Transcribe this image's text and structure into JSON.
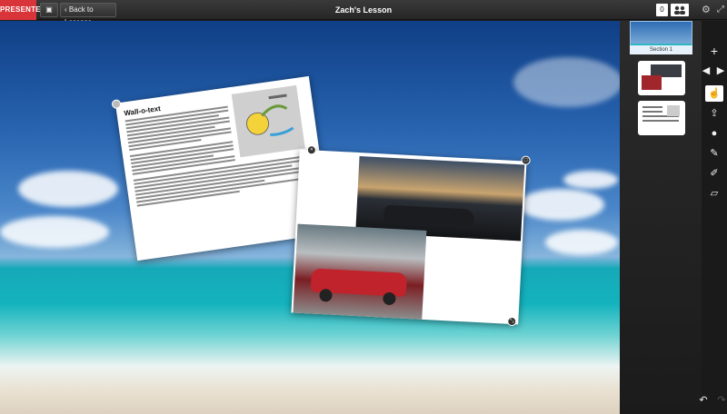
{
  "header": {
    "presenter_label": "PRESENTER",
    "back_label": "Back to Lessons",
    "title": "Zach's Lesson",
    "count": "0"
  },
  "sidebar": {
    "section_label": "Section 1"
  },
  "cards": {
    "text_card_title": "Wall-o-text"
  },
  "colors": {
    "presenter_red": "#d9343a",
    "toolbar_dark": "#2f2f2f",
    "sidebar_dark": "#1c1c1c"
  },
  "icons": {
    "folder": "folder-icon",
    "back": "chevron-left-icon",
    "people": "people-icon",
    "settings": "gear-icon",
    "fullscreen": "fullscreen-icon",
    "add": "plus-icon",
    "prev": "triangle-left-icon",
    "next": "triangle-right-icon",
    "select": "hand-pointer-icon",
    "share": "share-icon",
    "comment": "comment-icon",
    "pen": "pen-icon",
    "highlighter": "highlighter-icon",
    "eraser": "eraser-icon",
    "undo": "undo-icon",
    "redo": "redo-icon"
  }
}
